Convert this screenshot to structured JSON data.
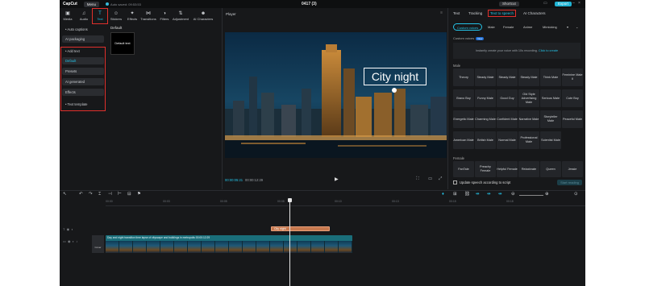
{
  "topbar": {
    "logo": "CapCut",
    "menu": "Menu",
    "autosave": "Auto saved: 09:53:53",
    "title": "0417 (3)",
    "shortcut": "Shortcut",
    "export": "Export"
  },
  "tools": [
    {
      "label": "Media",
      "icon": "media-icon",
      "glyph": "▣"
    },
    {
      "label": "Audio",
      "icon": "audio-icon",
      "glyph": "♫"
    },
    {
      "label": "Text",
      "icon": "text-icon",
      "glyph": "T"
    },
    {
      "label": "Stickers",
      "icon": "sticker-icon",
      "glyph": "☺"
    },
    {
      "label": "Effects",
      "icon": "effects-icon",
      "glyph": "✦"
    },
    {
      "label": "Transitions",
      "icon": "transitions-icon",
      "glyph": "⋈"
    },
    {
      "label": "Filters",
      "icon": "filters-icon",
      "glyph": "◑"
    },
    {
      "label": "Adjustment",
      "icon": "adjustment-icon",
      "glyph": "⇅"
    },
    {
      "label": "AI Characters",
      "icon": "ai-characters-icon",
      "glyph": "☻"
    }
  ],
  "sidebar": {
    "auto_captions": "• Auto captions",
    "ai_packaging": "AI packaging",
    "add_text": "• Add text",
    "items": [
      "Default",
      "Presets",
      "AI generated",
      "Effects"
    ],
    "text_template": "• Text template"
  },
  "left_content": {
    "section": "Default",
    "card": "Default text"
  },
  "player": {
    "title": "Player",
    "overlay_text": "City night",
    "time_current": "00:00:05:21",
    "time_total": "00:00:12:29"
  },
  "right_panel": {
    "tabs": [
      "Text",
      "Tracking",
      "Text to speech",
      "AI Characters"
    ],
    "chips": [
      "Custom voices",
      "Male",
      "Female",
      "Anime",
      "Mimicking"
    ],
    "custom_label": "Custom voices",
    "new_badge": "New",
    "custom_hint": "Instantly create your voice with 10s recording.",
    "custom_link": "Click to create",
    "male_label": "Male",
    "female_label": "Female",
    "voices_male": [
      "Theory",
      "Steady Male",
      "Steady Male",
      "Steady Male",
      "Think Male",
      "Feminine Male II",
      "Bravo Boy",
      "Funny Male",
      "Good Guy",
      "Old Style Advertising Male",
      "Serious Male",
      "Cute Boy",
      "Energetic Male",
      "Charming Male",
      "Confident Male",
      "Narrative Male",
      "Storyteller Male",
      "Peaceful Male",
      "American Male",
      "British Male",
      "Normal Male",
      "Professional Male",
      "Scientist Male"
    ],
    "voices_female": [
      "FanTale",
      "Preachy Female",
      "Helpful Female",
      "Relaxbrate",
      "Queen",
      "Jessie"
    ],
    "update_label": "Update speech according to script",
    "start_label": "Start reading"
  },
  "timeline": {
    "ticks": [
      "00:00",
      "00:03",
      "00:05",
      "00:08",
      "00:10",
      "00:13",
      "00:15",
      "00:18"
    ],
    "text_clip": "City night",
    "video_caption": "Day and night transition time lapse of cityscape and buildings in metropolis   00:00:12:29",
    "cover": "Cover"
  }
}
